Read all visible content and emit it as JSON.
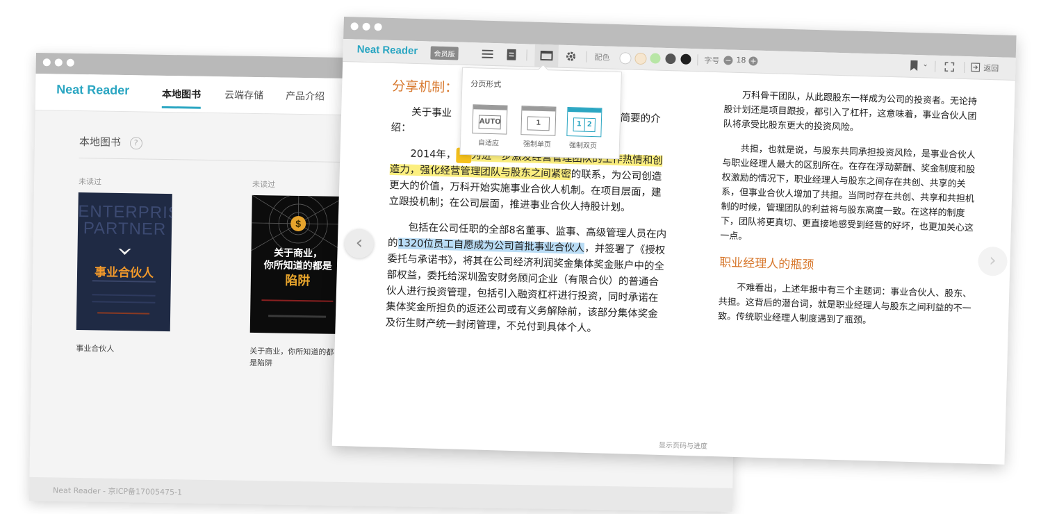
{
  "library_window": {
    "brand": "Neat Reader",
    "tabs": [
      {
        "label": "本地图书",
        "active": true
      },
      {
        "label": "云端存储",
        "active": false
      },
      {
        "label": "产品介绍",
        "active": false
      }
    ],
    "section_title": "本地图书",
    "help_icon": "?",
    "books": [
      {
        "status": "未读过",
        "title": "事业合伙人",
        "cover": {
          "line1": "ENTERPRISE",
          "line2": "PARTNER",
          "main_title": "事业合伙人"
        }
      },
      {
        "status": "未读过",
        "title": "关于商业，你所知道的都是陷阱",
        "cover": {
          "line1": "关于商业，",
          "line2": "你所知道的都是",
          "line3": "陷阱"
        }
      }
    ],
    "footer": "Neat Reader - 京ICP备17005475-1"
  },
  "reader_window": {
    "brand": "Neat Reader",
    "vip_badge": "会员版",
    "toolbar": {
      "color_label": "配色",
      "font_label": "字号",
      "font_size": "18",
      "decrease_icon": "−",
      "increase_icon": "+",
      "return_label": "返回",
      "colors": [
        "#ffffff",
        "#f6e6cf",
        "#b8e6a6",
        "#555555",
        "#1e1e1e"
      ]
    },
    "page_popup": {
      "title": "分页形式",
      "options": [
        {
          "icon_text": "AUTO",
          "label": "自适应",
          "selected": false
        },
        {
          "icon_text": "1",
          "label": "强制单页",
          "selected": false
        },
        {
          "icon_text_left": "1",
          "icon_text_right": "2",
          "label": "强制双页",
          "selected": true
        }
      ]
    },
    "left_page": {
      "heading": "分享机制：",
      "p1_a": "关于事业",
      "p1_b": "年年报中有简要的介绍：",
      "p2_year": "2014年，",
      "p2_quote_mark": "“",
      "p2_hl": "为进一步激发经营管理团队的工作热情和创造力，强化经营管理团队与股东之间紧密",
      "p2_rest": "的联系，为公司创造更大的价值，万科开始实施事业合伙人机制。在项目层面，建立跟投机制；在公司层面，推进事业合伙人持股计划。",
      "p3_a": "包括在公司任职的全部8名董事、监事、高级管理人员在内的",
      "p3_hl": "1320位员工自愿成为公司首批事业合伙人",
      "p3_b": "，并签署了《授权委托与承诺书》，将其在公司经济利润奖金集体奖金账户中的全部权益，委托给深圳盈安财务顾问企业（有限合伙）的普通合伙人进行投资管理，包括引入融资杠杆进行投资，同时承诺在集体奖金所担负的返还公司或有义务解除前，该部分集体奖金及衍生财产统一封闭管理，不兑付到具体个人。"
    },
    "right_page": {
      "p1": "万科骨干团队，从此跟股东一样成为公司的投资者。无论持股计划还是项目跟投，都引入了杠杆，这意味着，事业合伙人团队将承受比股东更大的投资风险。",
      "p2": "共担，也就是说，与股东共同承担投资风险，是事业合伙人与职业经理人最大的区别所在。在存在浮动薪酬、奖金制度和股权激励的情况下，职业经理人与股东之间存在共创、共享的关系，但事业合伙人增加了共担。当同时存在共创、共享和共担机制的时候，管理团队的利益将与股东高度一致。在这样的制度下，团队将更真切、更直接地感受到经营的好坏，也更加关心这一点。",
      "heading": "职业经理人的瓶颈",
      "p3": "不难看出，上述年报中有三个主题词：事业合伙人、股东、共担。这背后的潜台词，就是职业经理人与股东之间利益的不一致。传统职业经理人制度遇到了瓶颈。"
    },
    "progress_text": "显示页码与进度",
    "nav": {
      "prev": "‹",
      "next": "›"
    }
  }
}
